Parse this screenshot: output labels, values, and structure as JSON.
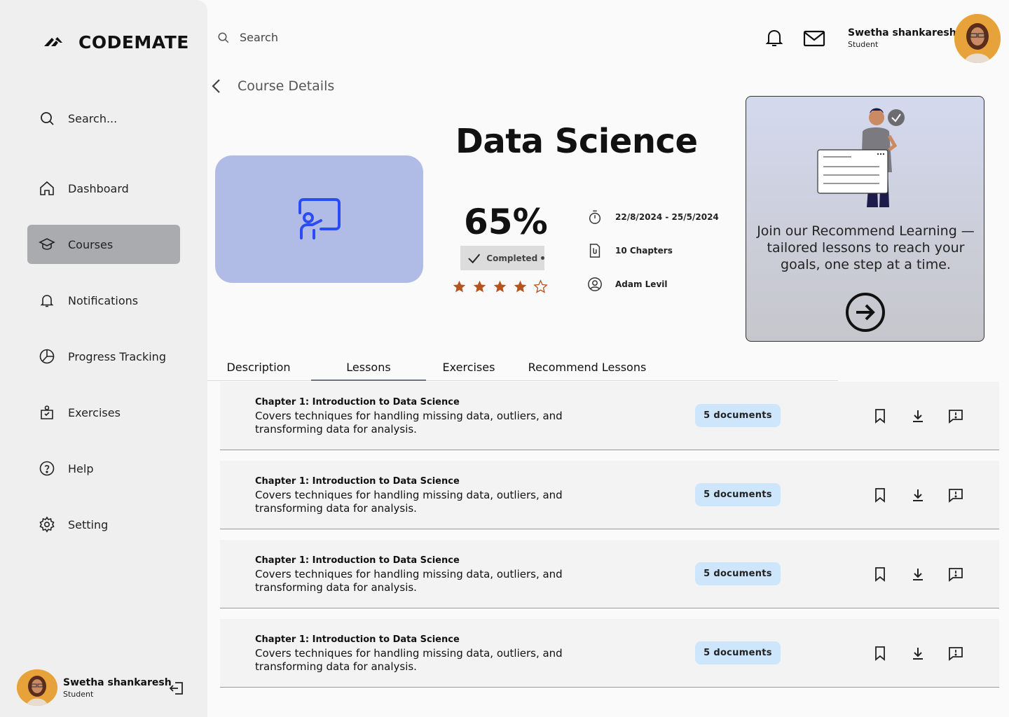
{
  "app": {
    "name": "CODEMATE"
  },
  "sidebar": {
    "search_placeholder": "Search...",
    "items": [
      {
        "label": "Dashboard",
        "icon": "home-icon"
      },
      {
        "label": "Courses",
        "icon": "graduation-cap-icon",
        "active": true
      },
      {
        "label": "Notifications",
        "icon": "bell-icon"
      },
      {
        "label": "Progress Tracking",
        "icon": "pie-chart-icon"
      },
      {
        "label": "Exercises",
        "icon": "exercise-bag-icon"
      },
      {
        "label": "Help",
        "icon": "help-icon"
      },
      {
        "label": "Setting",
        "icon": "gear-icon"
      }
    ],
    "user": {
      "name": "Swetha shankaresh",
      "role": "Student"
    }
  },
  "header": {
    "search_placeholder": "Search",
    "user": {
      "name": "Swetha shankaresh",
      "role": "Student"
    }
  },
  "breadcrumb": {
    "title": "Course Details"
  },
  "course": {
    "title": "Data Science",
    "progress": "65%",
    "status": "Completed",
    "rating": 4,
    "rating_max": 5,
    "dates": "22/8/2024 - 25/5/2024",
    "chapters": "10 Chapters",
    "instructor": "Adam Levil"
  },
  "promo": {
    "text": "Join our Recommend Learning — tailored lessons to reach your goals, one step at a time."
  },
  "tabs": [
    {
      "label": "Description"
    },
    {
      "label": "Lessons",
      "active": true
    },
    {
      "label": "Exercises"
    },
    {
      "label": "Recommend Lessons"
    }
  ],
  "lessons": [
    {
      "title": "Chapter 1: Introduction to Data Science",
      "description": "Covers techniques for handling missing data, outliers, and transforming data for analysis.",
      "documents": "5 documents"
    },
    {
      "title": "Chapter 1: Introduction to Data Science",
      "description": "Covers techniques for handling missing data, outliers, and transforming data for analysis.",
      "documents": "5 documents"
    },
    {
      "title": "Chapter 1: Introduction to Data Science",
      "description": "Covers techniques for handling missing data, outliers, and transforming data for analysis.",
      "documents": "5 documents"
    },
    {
      "title": "Chapter 1: Introduction to Data Science",
      "description": "Covers techniques for handling missing data, outliers, and transforming data for analysis.",
      "documents": "5 documents"
    }
  ],
  "colors": {
    "accent": "#2b4cf5",
    "course_image_bg": "#b0bce6",
    "active_nav": "#a9abae",
    "star": "#b5551d",
    "docs_badge": "#cde6fb"
  }
}
